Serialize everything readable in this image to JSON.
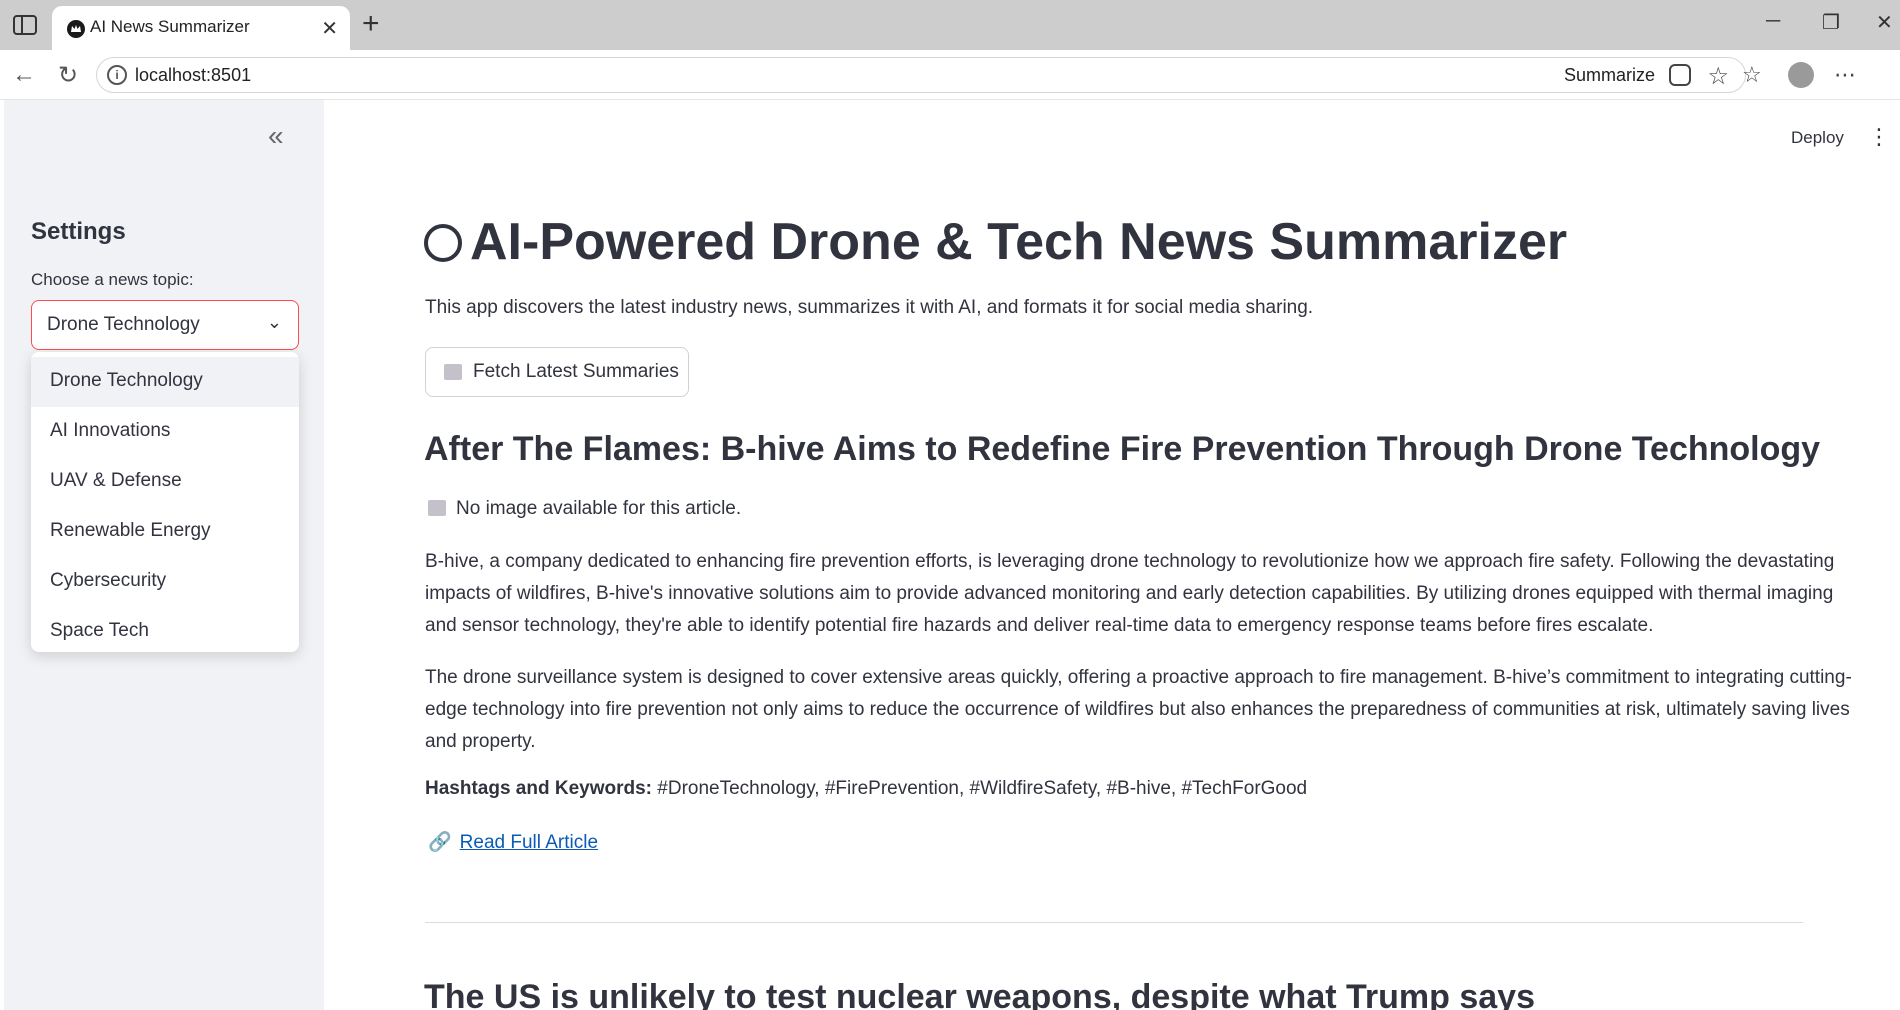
{
  "browser": {
    "tab_title": "AI News Summarizer",
    "url": "localhost:8501",
    "summarize_label": "Summarize"
  },
  "sidebar": {
    "title": "Settings",
    "topic_label": "Choose a news topic:",
    "selected_topic": "Drone Technology",
    "topics": [
      "Drone Technology",
      "AI Innovations",
      "UAV & Defense",
      "Renewable Energy",
      "Cybersecurity",
      "Space Tech"
    ]
  },
  "header": {
    "deploy_label": "Deploy"
  },
  "main": {
    "title": "AI-Powered Drone & Tech News Summarizer",
    "intro": "This app discovers the latest industry news, summarizes it with AI, and formats it for social media sharing.",
    "fetch_button": "Fetch Latest Summaries",
    "articles": [
      {
        "title": "After The Flames: B-hive Aims to Redefine Fire Prevention Through Drone Technology",
        "no_image": "No image available for this article.",
        "paragraphs": [
          "B-hive, a company dedicated to enhancing fire prevention efforts, is leveraging drone technology to revolutionize how we approach fire safety. Following the devastating impacts of wildfires, B-hive's innovative solutions aim to provide advanced monitoring and early detection capabilities. By utilizing drones equipped with thermal imaging and sensor technology, they're able to identify potential fire hazards and deliver real-time data to emergency response teams before fires escalate.",
          "The drone surveillance system is designed to cover extensive areas quickly, offering a proactive approach to fire management. B-hive’s commitment to integrating cutting-edge technology into fire prevention not only aims to reduce the occurrence of wildfires but also enhances the preparedness of communities at risk, ultimately saving lives and property."
        ],
        "hashtags_label": "Hashtags and Keywords:",
        "hashtags": "#DroneTechnology, #FirePrevention, #WildfireSafety, #B-hive, #TechForGood",
        "read_more": "Read Full Article"
      },
      {
        "title": "The US is unlikely to test nuclear weapons, despite what Trump says"
      }
    ]
  }
}
